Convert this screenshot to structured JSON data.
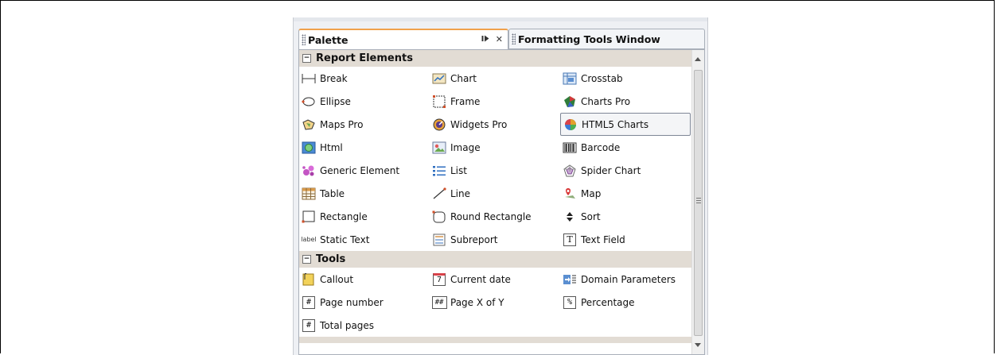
{
  "tabs": {
    "palette": "Palette",
    "formatting": "Formatting Tools Window",
    "dock_icon": "dock-icon",
    "close_icon": "close-icon"
  },
  "sections": {
    "report": {
      "title": "Report Elements",
      "items": [
        {
          "label": "Break",
          "icon": "break-icon"
        },
        {
          "label": "Chart",
          "icon": "chart-icon"
        },
        {
          "label": "Crosstab",
          "icon": "crosstab-icon"
        },
        {
          "label": "Ellipse",
          "icon": "ellipse-icon"
        },
        {
          "label": "Frame",
          "icon": "frame-icon"
        },
        {
          "label": "Charts Pro",
          "icon": "charts-pro-icon"
        },
        {
          "label": "Maps Pro",
          "icon": "maps-pro-icon"
        },
        {
          "label": "Widgets Pro",
          "icon": "widgets-pro-icon"
        },
        {
          "label": "HTML5 Charts",
          "icon": "html5-charts-icon"
        },
        {
          "label": "Html",
          "icon": "html-icon"
        },
        {
          "label": "Image",
          "icon": "image-icon"
        },
        {
          "label": "Barcode",
          "icon": "barcode-icon"
        },
        {
          "label": "Generic Element",
          "icon": "generic-element-icon"
        },
        {
          "label": "List",
          "icon": "list-icon"
        },
        {
          "label": "Spider Chart",
          "icon": "spider-chart-icon"
        },
        {
          "label": "Table",
          "icon": "table-icon"
        },
        {
          "label": "Line",
          "icon": "line-icon"
        },
        {
          "label": "Map",
          "icon": "map-icon"
        },
        {
          "label": "Rectangle",
          "icon": "rectangle-icon"
        },
        {
          "label": "Round Rectangle",
          "icon": "round-rectangle-icon"
        },
        {
          "label": "Sort",
          "icon": "sort-icon"
        },
        {
          "label": "Static Text",
          "icon": "static-text-icon",
          "icon_text": "label"
        },
        {
          "label": "Subreport",
          "icon": "subreport-icon"
        },
        {
          "label": "Text Field",
          "icon": "text-field-icon",
          "icon_text": "T"
        }
      ]
    },
    "tools": {
      "title": "Tools",
      "items": [
        {
          "label": "Callout",
          "icon": "callout-icon"
        },
        {
          "label": "Current date",
          "icon": "current-date-icon",
          "icon_text": "7"
        },
        {
          "label": "Domain Parameters",
          "icon": "domain-parameters-icon"
        },
        {
          "label": "Page number",
          "icon": "page-number-icon",
          "icon_text": "#"
        },
        {
          "label": "Page X of Y",
          "icon": "page-x-of-y-icon",
          "icon_text": "##"
        },
        {
          "label": "Percentage",
          "icon": "percentage-icon",
          "icon_text": "%"
        },
        {
          "label": "Total pages",
          "icon": "total-pages-icon",
          "icon_text": "#"
        }
      ]
    }
  },
  "colors": {
    "active_tab_accent": "#f0a14b",
    "section_header": "#e2dcd4"
  }
}
